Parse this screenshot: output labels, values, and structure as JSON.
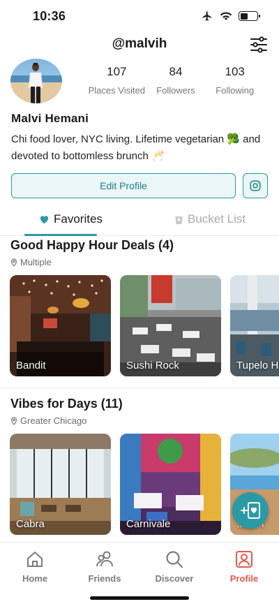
{
  "status_bar": {
    "time": "10:36"
  },
  "header": {
    "username": "@malvih"
  },
  "profile": {
    "name": "Malvi Hemani",
    "bio": "Chi food lover, NYC living. Lifetime vegetarian 🥦 and devoted to bottomless brunch 🥂",
    "stats": [
      {
        "value": "107",
        "label": "Places Visited"
      },
      {
        "value": "84",
        "label": "Followers"
      },
      {
        "value": "103",
        "label": "Following"
      }
    ],
    "edit_label": "Edit Profile"
  },
  "tabs": [
    {
      "label": "Favorites",
      "active": true
    },
    {
      "label": "Bucket List",
      "active": false
    }
  ],
  "sections": [
    {
      "title": "Good Happy Hour Deals (4)",
      "location": "Multiple",
      "cards": [
        {
          "name": "Bandit"
        },
        {
          "name": "Sushi Rock"
        },
        {
          "name": "Tupelo H"
        }
      ]
    },
    {
      "title": "Vibes for Days (11)",
      "location": "Greater Chicago",
      "cards": [
        {
          "name": "Cabra"
        },
        {
          "name": "Carnivale"
        },
        {
          "name": "...an T"
        }
      ]
    }
  ],
  "nav": [
    {
      "label": "Home",
      "icon": "home-icon",
      "active": false
    },
    {
      "label": "Friends",
      "icon": "friends-icon",
      "active": false
    },
    {
      "label": "Discover",
      "icon": "search-icon",
      "active": false
    },
    {
      "label": "Profile",
      "icon": "profile-icon",
      "active": true
    }
  ],
  "colors": {
    "accent": "#2a9aa6",
    "active_nav": "#e05a4e"
  }
}
